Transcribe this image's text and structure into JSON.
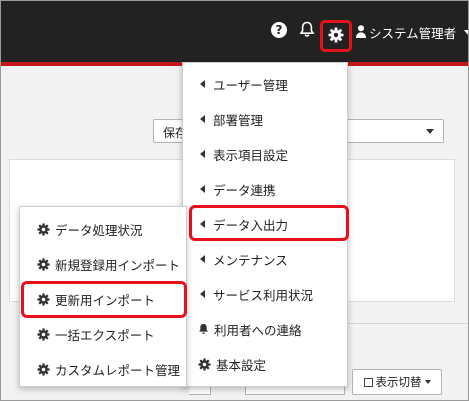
{
  "header": {
    "help_icon": "question-circle-icon",
    "bell_icon": "bell-icon",
    "settings_icon": "gear-icon",
    "user_icon": "user-icon",
    "user_name": "システム管理者",
    "help_glyph": "?"
  },
  "filter": {
    "select_value": "保存"
  },
  "settings_menu": {
    "items": [
      {
        "label": "ユーザー管理",
        "icon": "caret-left-icon"
      },
      {
        "label": "部署管理",
        "icon": "caret-left-icon"
      },
      {
        "label": "表示項目設定",
        "icon": "caret-left-icon"
      },
      {
        "label": "データ連携",
        "icon": "caret-left-icon"
      },
      {
        "label": "データ入出力",
        "icon": "caret-left-icon",
        "highlighted": true
      },
      {
        "label": "メンテナンス",
        "icon": "caret-left-icon"
      },
      {
        "label": "サービス利用状況",
        "icon": "caret-left-icon"
      },
      {
        "label": "利用者への連絡",
        "icon": "bell-icon"
      },
      {
        "label": "基本設定",
        "icon": "gear-icon"
      }
    ]
  },
  "data_io_submenu": {
    "items": [
      {
        "label": "データ処理状況",
        "icon": "gear-icon"
      },
      {
        "label": "新規登録用インポート",
        "icon": "gear-icon"
      },
      {
        "label": "更新用インポート",
        "icon": "gear-icon",
        "highlighted": true
      },
      {
        "label": "一括エクスポート",
        "icon": "gear-icon"
      },
      {
        "label": "カスタムレポート管理",
        "icon": "gear-icon"
      }
    ]
  },
  "toolbar": {
    "view_toggle_label": "表示切替"
  },
  "colors": {
    "header_bg": "#222222",
    "accent_red": "#c4161c",
    "highlight_red": "#e8101a",
    "page_bg": "#f2f2f2"
  }
}
